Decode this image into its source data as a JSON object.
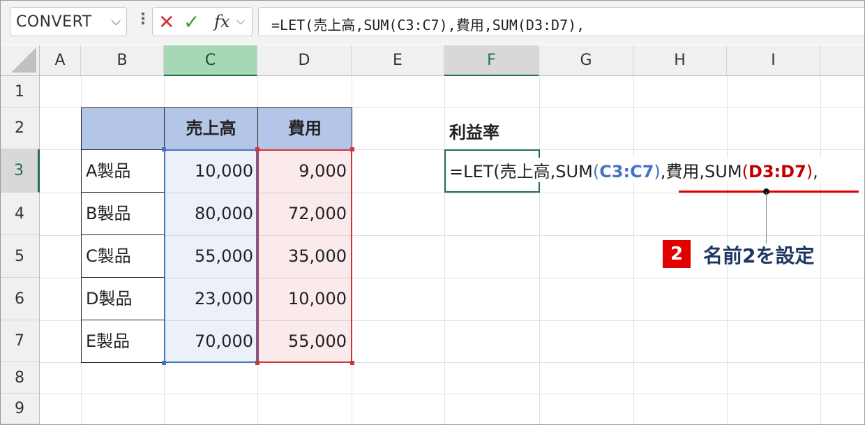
{
  "formula_bar": {
    "name_box": "CONVERT",
    "name_box_chevron": "⌵",
    "more_icon": "⋮",
    "cancel_icon": "✕",
    "enter_icon": "✓",
    "fx_label": "fx",
    "fx_chevron": "⌵",
    "formula": "=LET(売上高,SUM(C3:C7),費用,SUM(D3:D7),"
  },
  "columns": [
    "A",
    "B",
    "C",
    "D",
    "E",
    "F",
    "G",
    "H",
    "I"
  ],
  "rows": [
    "1",
    "2",
    "3",
    "4",
    "5",
    "6",
    "7",
    "8",
    "9"
  ],
  "table": {
    "headers": [
      "",
      "売上高",
      "費用"
    ],
    "rows": [
      {
        "label": "A製品",
        "sales": "10,000",
        "cost": "9,000"
      },
      {
        "label": "B製品",
        "sales": "80,000",
        "cost": "72,000"
      },
      {
        "label": "C製品",
        "sales": "55,000",
        "cost": "35,000"
      },
      {
        "label": "D製品",
        "sales": "23,000",
        "cost": "10,000"
      },
      {
        "label": "E製品",
        "sales": "70,000",
        "cost": "55,000"
      }
    ]
  },
  "profit_label": "利益率",
  "cell_edit": {
    "prefix": "=LET(売上高,SUM",
    "open1": "(",
    "ref1": "C3:C7",
    "close1": ")",
    "middle": ",費用,SUM",
    "open2": "(",
    "ref2": "D3:D7",
    "close2": ")",
    "suffix": ","
  },
  "annotation": {
    "badge": "2",
    "text": "名前2を設定"
  },
  "colors": {
    "ref_blue": "#4472c4",
    "ref_red": "#c00000",
    "header_fill": "#b4c6e7",
    "active_green": "#1e7145",
    "annotation_red": "#e00000",
    "annotation_text": "#1f3864"
  }
}
